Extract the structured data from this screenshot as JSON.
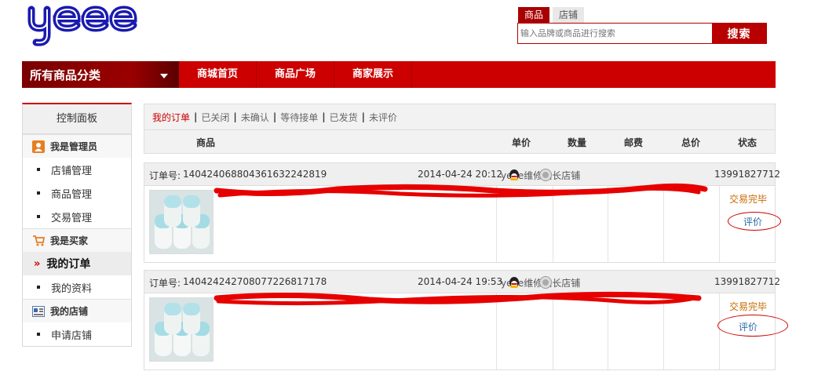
{
  "brand": {
    "logo_text": "yeee"
  },
  "search": {
    "tabs": [
      "商品",
      "店铺"
    ],
    "placeholder": "输入品牌或商品进行搜索",
    "button_label": "搜索"
  },
  "nav": {
    "category_label": "所有商品分类",
    "items": [
      "商城首页",
      "商品广场",
      "商家展示"
    ]
  },
  "sidebar": {
    "title": "控制面板",
    "groups": [
      {
        "label": "我是管理员",
        "icon": "person-icon",
        "items": [
          "店铺管理",
          "商品管理",
          "交易管理"
        ]
      },
      {
        "label": "我是买家",
        "icon": "cart-icon",
        "items": [
          "我的订单",
          "我的资料"
        ]
      },
      {
        "label": "我的店铺",
        "icon": "store-icon",
        "items": [
          "申请店铺"
        ]
      }
    ],
    "active_item": "我的订单"
  },
  "filters": [
    "我的订单",
    "已关闭",
    "未确认",
    "等待接单",
    "已发货",
    "未评价"
  ],
  "table_headers": [
    "商品",
    "单价",
    "数量",
    "邮费",
    "总价",
    "状态"
  ],
  "orders": [
    {
      "order_no_label": "订单号:",
      "order_no": "140424068804361632242819",
      "datetime": "2014-04-24 20:12",
      "shop": "yeee维修站长店铺",
      "phone": "13991827712",
      "status": "交易完毕",
      "action": "评价"
    },
    {
      "order_no_label": "订单号:",
      "order_no": "140424242708077226817178",
      "datetime": "2014-04-24 19:53",
      "shop": "yeee维修站长店铺",
      "phone": "13991827712",
      "status": "交易完毕",
      "action": "评价"
    }
  ],
  "colors": {
    "brand_red": "#cc0000",
    "dark_red": "#a80000",
    "logo_blue": "#1a1ab0",
    "status_orange": "#c96b00",
    "link_blue": "#2a6aa8"
  }
}
